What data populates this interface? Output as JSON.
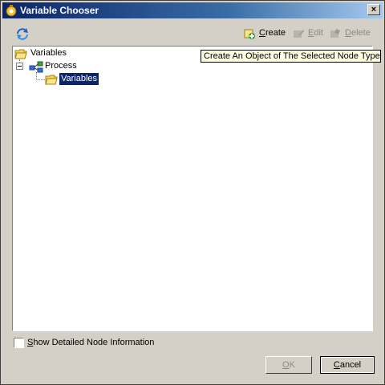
{
  "window": {
    "title": "Variable Chooser",
    "close_label": "×"
  },
  "toolbar": {
    "refresh_icon": "refresh-icon",
    "create_prefix": "",
    "create_ul": "C",
    "create_rest": "reate",
    "edit_ul": "E",
    "edit_rest": "dit",
    "delete_ul": "D",
    "delete_rest": "elete"
  },
  "tree": {
    "root_label": "Variables",
    "process_label": "Process",
    "child_label": "Variables"
  },
  "tooltip": {
    "text": "Create An Object of The Selected Node Type"
  },
  "options": {
    "show_detailed_ul": "S",
    "show_detailed_rest": "how Detailed Node Information",
    "checked": false
  },
  "buttons": {
    "ok_ul": "O",
    "ok_rest": "K",
    "cancel_ul": "C",
    "cancel_rest": "ancel"
  },
  "colors": {
    "titlebar_start": "#0a246a",
    "titlebar_end": "#a6caf0",
    "selection": "#0a246a",
    "tooltip_bg": "#ffffe1",
    "face": "#d4d0c8"
  }
}
